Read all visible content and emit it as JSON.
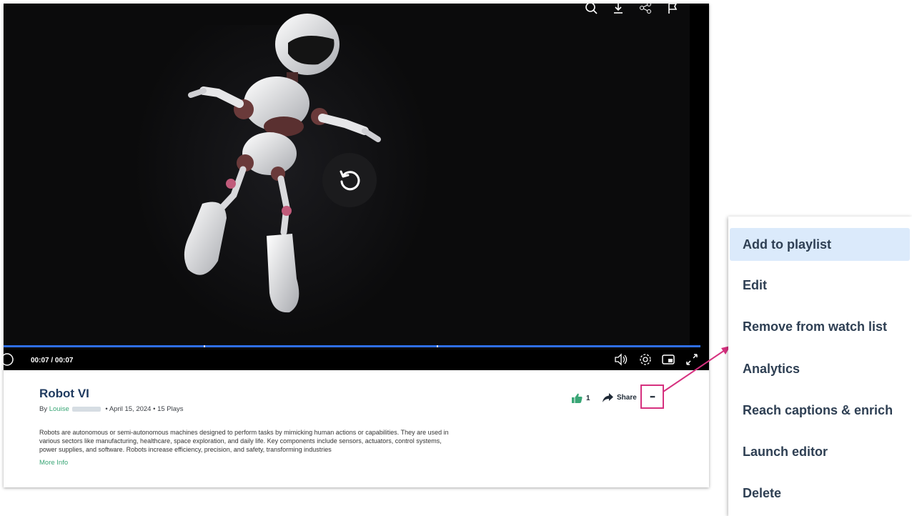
{
  "player": {
    "time": "00:07 / 00:07",
    "colors": {
      "progress": "#2f6fe8",
      "background": "#0b0b0c"
    },
    "progress_fraction": 1.0
  },
  "video_info": {
    "title": "Robot VI",
    "by_prefix": "By",
    "author": "Louise",
    "date": "April 15, 2024",
    "plays": "15 Plays",
    "separator": "•",
    "description": "Robots are autonomous or semi-autonomous machines designed to perform tasks by mimicking human actions or capabilities. They are used in various sectors like manufacturing, healthcare, space exploration, and daily life. Key components include sensors, actuators, control systems, power supplies, and software. Robots increase efficiency, precision, and safety, transforming industries",
    "more_info": "More Info",
    "likes": "1",
    "share_label": "Share",
    "more_label": "•••"
  },
  "menu": {
    "items": [
      {
        "label": "Add to playlist",
        "active": true
      },
      {
        "label": "Edit"
      },
      {
        "label": "Remove from watch list"
      },
      {
        "label": "Analytics"
      },
      {
        "label": "Reach captions & enrich"
      },
      {
        "label": "Launch editor"
      },
      {
        "label": "Delete"
      }
    ]
  },
  "colors": {
    "accent_green": "#3aa676",
    "highlight_pink": "#d6317f",
    "menu_active": "#dbeafb",
    "title_navy": "#1f3a5f"
  }
}
